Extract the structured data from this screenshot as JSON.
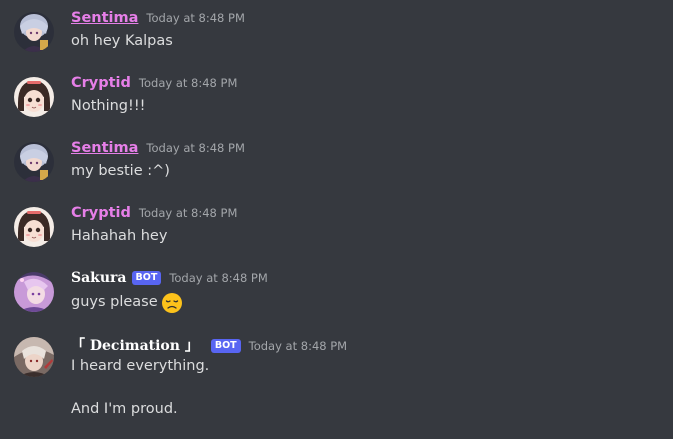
{
  "messages": [
    {
      "author": "Sentima",
      "timestamp": "Today at 8:48 PM",
      "lines": [
        "oh hey Kalpas"
      ],
      "avatar": "sentima-avatar"
    },
    {
      "author": "Cryptid",
      "timestamp": "Today at 8:48 PM",
      "lines": [
        "Nothing!!!"
      ],
      "avatar": "cryptid-avatar"
    },
    {
      "author": "Sentima",
      "timestamp": "Today at 8:48 PM",
      "lines": [
        "my bestie :^)"
      ],
      "avatar": "sentima-avatar"
    },
    {
      "author": "Cryptid",
      "timestamp": "Today at 8:48 PM",
      "lines": [
        "Hahahah hey"
      ],
      "avatar": "cryptid-avatar"
    },
    {
      "author": "Sakura",
      "badge": "BOT",
      "timestamp": "Today at 8:48 PM",
      "lines": [
        "guys please"
      ],
      "emoji": "disappointed-face-emoji",
      "avatar": "sakura-avatar"
    },
    {
      "author": "「 Decimation 」",
      "badge": "BOT",
      "timestamp": "Today at 8:48 PM",
      "lines": [
        "I heard everything.",
        "And I'm proud."
      ],
      "avatar": "decimation-avatar"
    }
  ],
  "colors": {
    "background": "#36393f",
    "username_pink": "#e67fe8",
    "bot_badge": "#5865f2",
    "timestamp": "#a3a6aa",
    "message_text": "#dcddde"
  }
}
